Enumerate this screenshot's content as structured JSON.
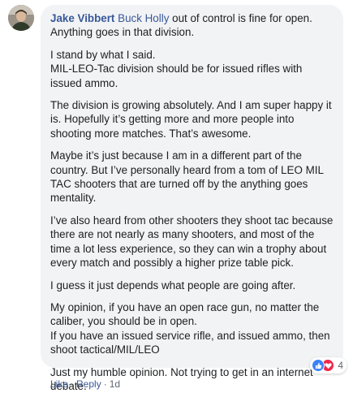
{
  "comment": {
    "author": "Jake Vibbert",
    "mention": "Buck Holly",
    "paragraphs": [
      {
        "lines": [
          "out of control is fine for open.",
          "Anything goes in that division."
        ]
      },
      {
        "lines": [
          "I stand by what I said.",
          "MIL-LEO-Tac division should be for issued rifles with",
          "issued ammo."
        ]
      },
      {
        "lines": [
          "The division is growing absolutely. And I am super happy it",
          "is. Hopefully it’s getting more and more people into",
          "shooting more matches. That’s awesome."
        ]
      },
      {
        "lines": [
          "Maybe it’s just because I am in a different part of the",
          "country. But I’ve personally heard from a tom of LEO MIL",
          "TAC shooters that are turned off by the anything goes",
          "mentality."
        ]
      },
      {
        "lines": [
          "I’ve also heard from other shooters they shoot tac because",
          "there are not nearly as many shooters, and most of the",
          "time a lot less experience, so they can win a trophy about",
          "every match and possibly a higher prize table pick."
        ]
      },
      {
        "lines": [
          "I guess it just depends what people are going after."
        ]
      },
      {
        "lines": [
          "My opinion, if you have an open race gun, no matter the",
          "caliber, you should be in open.",
          "If you have an issued service rifle, and issued ammo, then",
          "shoot tactical/MIL/LEO"
        ]
      },
      {
        "lines": [
          "Just my humble opinion. Not trying to get in an internet",
          "debate."
        ]
      }
    ],
    "reactions": {
      "count": "4",
      "icons": [
        "like-icon",
        "love-icon"
      ],
      "colors": {
        "like": "#3b82f6",
        "love": "#f0284a"
      }
    },
    "actions": {
      "like": "Like",
      "reply": "Reply",
      "separator": "·",
      "time": "1d"
    }
  },
  "colors": {
    "link": "#385898",
    "bubble": "#f2f3f5",
    "meta": "#606770"
  }
}
